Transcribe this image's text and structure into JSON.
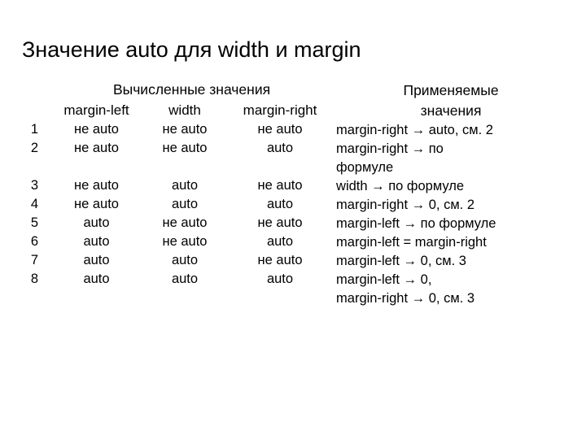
{
  "slide": {
    "title": "Значение auto для width и margin",
    "background_color": "#ffffff",
    "text_color": "#000000",
    "rule_color": "#6b6b6b"
  },
  "table": {
    "group_headers": {
      "computed": "Вычисленные значения",
      "applied_line1": "Применяемые",
      "applied_line2": "значения"
    },
    "sub_headers": {
      "num": "",
      "margin_left": "margin-left",
      "width": "width",
      "margin_right": "margin-right"
    },
    "rows": [
      {
        "num": "1",
        "margin_left": "не auto",
        "width": "не auto",
        "margin_right": "не auto",
        "applied_line1": "margin-right → auto, см. 2",
        "applied_line2": ""
      },
      {
        "num": "2",
        "margin_left": "не auto",
        "width": "не auto",
        "margin_right": "auto",
        "applied_line1": "margin-right → по",
        "applied_line2": "формуле"
      },
      {
        "num": "3",
        "margin_left": "не auto",
        "width": "auto",
        "margin_right": "не auto",
        "applied_line1": "width → по формуле",
        "applied_line2": ""
      },
      {
        "num": "4",
        "margin_left": "не auto",
        "width": "auto",
        "margin_right": "auto",
        "applied_line1": "margin-right → 0, см. 2",
        "applied_line2": ""
      },
      {
        "num": "5",
        "margin_left": "auto",
        "width": "не auto",
        "margin_right": "не auto",
        "applied_line1": "margin-left → по формуле",
        "applied_line2": ""
      },
      {
        "num": "6",
        "margin_left": "auto",
        "width": "не auto",
        "margin_right": "auto",
        "applied_line1": "margin-left = margin-right",
        "applied_line2": ""
      },
      {
        "num": "7",
        "margin_left": "auto",
        "width": "auto",
        "margin_right": "не auto",
        "applied_line1": "margin-left → 0, см. 3",
        "applied_line2": ""
      },
      {
        "num": "8",
        "margin_left": "auto",
        "width": "auto",
        "margin_right": "auto",
        "applied_line1": "margin-left → 0,",
        "applied_line2": "margin-right → 0, см. 3"
      }
    ]
  }
}
